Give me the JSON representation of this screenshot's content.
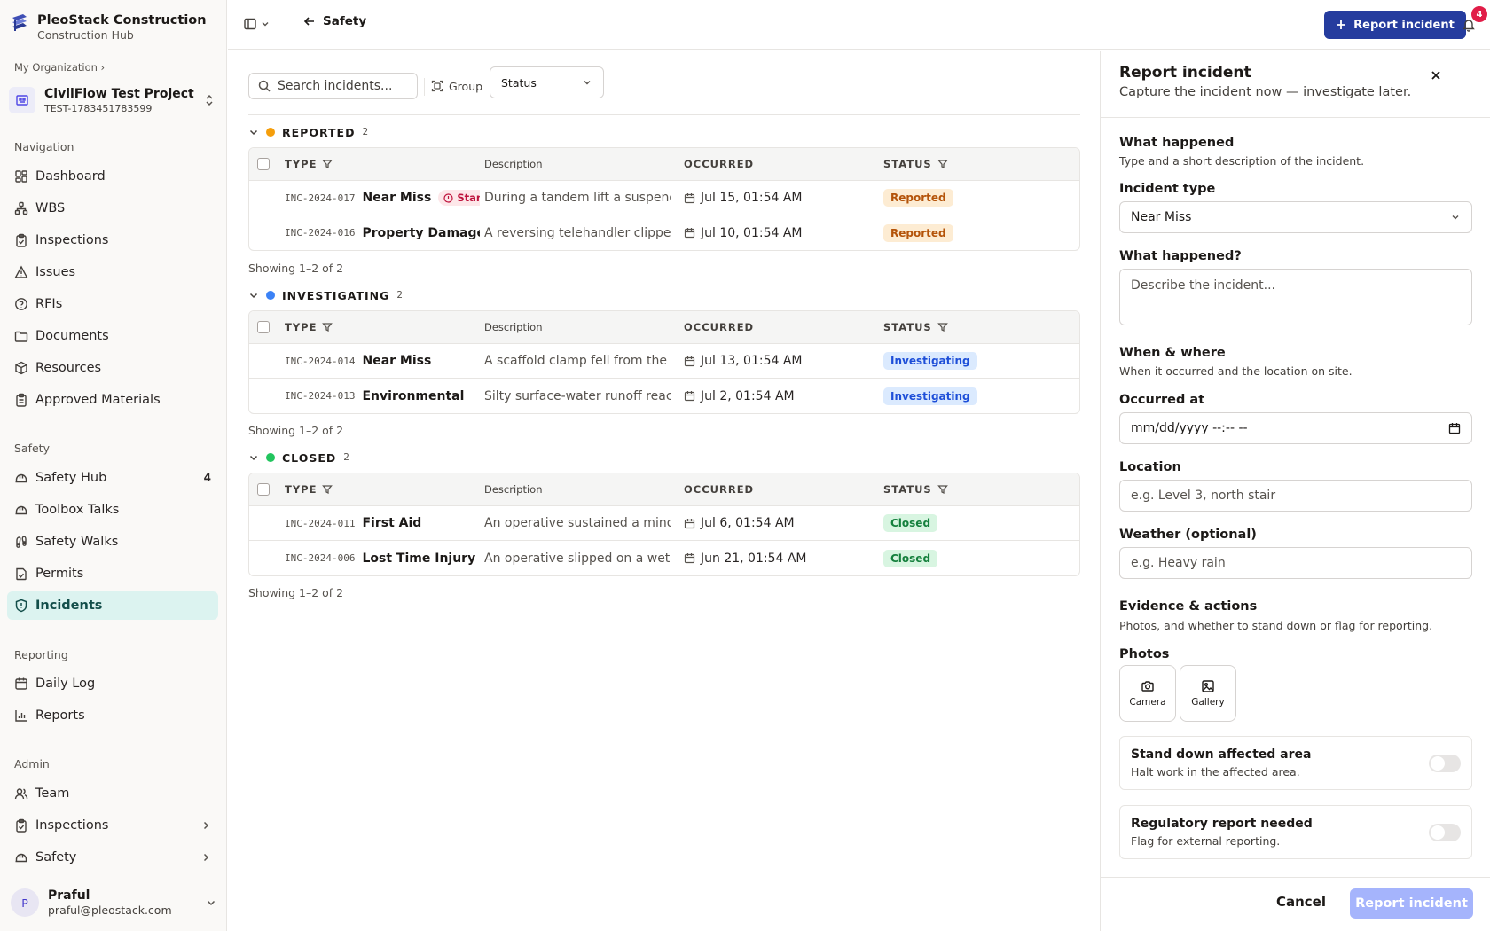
{
  "brand": {
    "name": "PleoStack Construction",
    "sub": "Construction Hub"
  },
  "org_crumb": "My Organization ›",
  "project": {
    "name": "CivilFlow Test Project (U...",
    "code": "TEST-1783451783599"
  },
  "nav_sections": {
    "navigation": "Navigation",
    "safety": "Safety",
    "reporting": "Reporting",
    "admin": "Admin"
  },
  "nav": {
    "dashboard": "Dashboard",
    "wbs": "WBS",
    "inspections": "Inspections",
    "issues": "Issues",
    "rfis": "RFIs",
    "documents": "Documents",
    "resources": "Resources",
    "approved_materials": "Approved Materials",
    "safety_hub": "Safety Hub",
    "safety_hub_badge": "4",
    "toolbox_talks": "Toolbox Talks",
    "safety_walks": "Safety Walks",
    "permits": "Permits",
    "incidents": "Incidents",
    "daily_log": "Daily Log",
    "reports": "Reports",
    "team": "Team",
    "admin_inspections": "Inspections",
    "admin_safety": "Safety"
  },
  "user": {
    "initial": "P",
    "name": "Praful",
    "email": "praful@pleostack.com"
  },
  "header": {
    "back_label": "Safety",
    "report_button": "Report incident",
    "notifications_count": "4"
  },
  "toolbar": {
    "search_placeholder": "Search incidents...",
    "group_label": "Group",
    "group_value": "Status"
  },
  "columns": {
    "type": "TYPE",
    "description": "Description",
    "occurred": "OCCURRED",
    "status": "STATUS"
  },
  "groups": [
    {
      "name": "REPORTED",
      "count": "2",
      "color": "#f59e0b",
      "showing": "Showing 1–2 of 2",
      "rows": [
        {
          "id": "INC-2024-017",
          "type": "Near Miss",
          "tag": "Stan",
          "description": "During a tandem lift a suspend",
          "occurred": "Jul 15, 01:54 AM",
          "status": "Reported"
        },
        {
          "id": "INC-2024-016",
          "type": "Property Damage",
          "description": "A reversing telehandler clipped",
          "occurred": "Jul 10, 01:54 AM",
          "status": "Reported"
        }
      ]
    },
    {
      "name": "INVESTIGATING",
      "count": "2",
      "color": "#3b82f6",
      "showing": "Showing 1–2 of 2",
      "rows": [
        {
          "id": "INC-2024-014",
          "type": "Near Miss",
          "description": "A scaffold clamp fell from the L",
          "occurred": "Jul 13, 01:54 AM",
          "status": "Investigating"
        },
        {
          "id": "INC-2024-013",
          "type": "Environmental",
          "description": "Silty surface-water runoff reac",
          "occurred": "Jul 2, 01:54 AM",
          "status": "Investigating"
        }
      ]
    },
    {
      "name": "CLOSED",
      "count": "2",
      "color": "#22c55e",
      "showing": "Showing 1–2 of 2",
      "rows": [
        {
          "id": "INC-2024-011",
          "type": "First Aid",
          "description": "An operative sustained a minor",
          "occurred": "Jul 6, 01:54 AM",
          "status": "Closed"
        },
        {
          "id": "INC-2024-006",
          "type": "Lost Time Injury",
          "description": "An operative slipped on a wet s",
          "occurred": "Jun 21, 01:54 AM",
          "status": "Closed"
        }
      ]
    }
  ],
  "panel": {
    "title": "Report incident",
    "subtitle": "Capture the incident now — investigate later.",
    "what_title": "What happened",
    "what_sub": "Type and a short description of the incident.",
    "type_label": "Incident type",
    "type_value": "Near Miss",
    "happened_label": "What happened?",
    "happened_placeholder": "Describe the incident...",
    "when_title": "When & where",
    "when_sub": "When it occurred and the location on site.",
    "occurred_label": "Occurred at",
    "occurred_placeholder": "mm/dd/yyyy --:-- --",
    "location_label": "Location",
    "location_placeholder": "e.g. Level 3, north stair",
    "weather_label": "Weather (optional)",
    "weather_placeholder": "e.g. Heavy rain",
    "evidence_title": "Evidence & actions",
    "evidence_sub": "Photos, and whether to stand down or flag for reporting.",
    "photos_label": "Photos",
    "camera": "Camera",
    "gallery": "Gallery",
    "standdown_title": "Stand down affected area",
    "standdown_sub": "Halt work in the affected area.",
    "regulatory_title": "Regulatory report needed",
    "regulatory_sub": "Flag for external reporting.",
    "cancel": "Cancel",
    "submit": "Report incident"
  }
}
